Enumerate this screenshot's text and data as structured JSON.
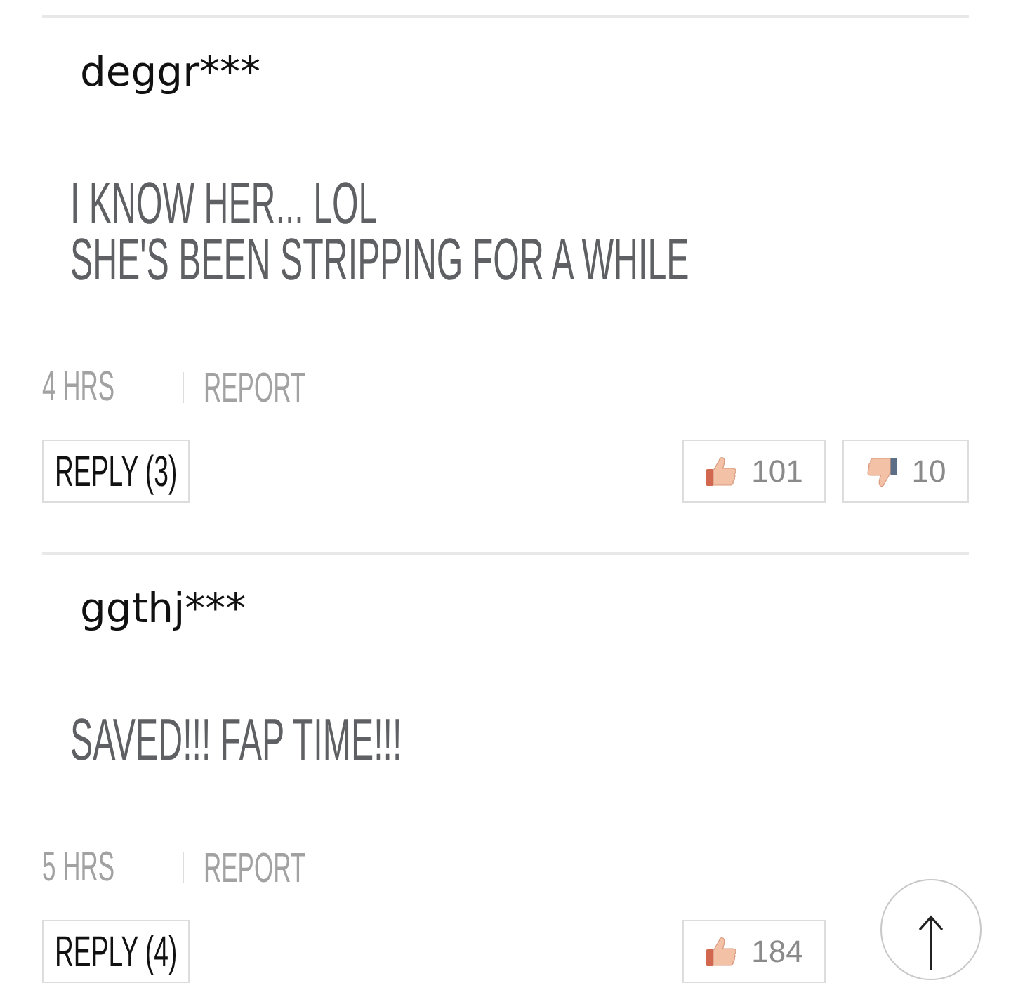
{
  "comments": [
    {
      "username": "deggr***",
      "body": "I KNOW HER... LOL\nSHE'S BEEN STRIPPING FOR A WHILE",
      "time": "4 HRS",
      "report": "REPORT",
      "reply": "REPLY (3)",
      "likes": "101",
      "dislikes": "10"
    },
    {
      "username": "ggthj***",
      "body": "SAVED!!! FAP TIME!!!",
      "time": "5 HRS",
      "report": "REPORT",
      "reply": "REPLY (4)",
      "likes": "184"
    }
  ]
}
